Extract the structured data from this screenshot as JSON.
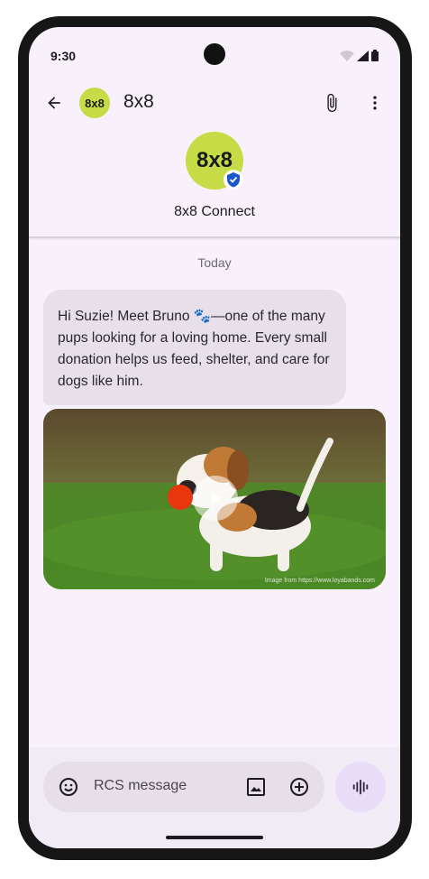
{
  "status_bar": {
    "time": "9:30"
  },
  "top_bar": {
    "avatar_text": "8x8",
    "title": "8x8"
  },
  "profile": {
    "avatar_text": "8x8",
    "name": "8x8 Connect"
  },
  "conversation": {
    "date_separator": "Today",
    "messages": [
      {
        "text": "Hi Suzie! Meet Bruno 🐾—one of the many pups looking for a loving home. Every small donation helps us feed, shelter, and care for dogs like him."
      }
    ],
    "media": {
      "credit": "Image from https://www.loyabands.com"
    }
  },
  "compose": {
    "placeholder": "RCS message"
  },
  "colors": {
    "avatar": "#c6dc46",
    "verified": "#1a56c8",
    "bubble": "#e7e0eb",
    "background": "#f8f1fb",
    "voice_button": "#e8dcf7"
  },
  "icons": {
    "back": "arrow-left-icon",
    "attach": "paperclip-icon",
    "more": "more-vertical-icon",
    "verified": "verified-shield-icon",
    "play": "play-icon",
    "emoji": "emoji-icon",
    "gallery": "image-icon",
    "add": "add-circle-icon",
    "voice": "waveform-icon"
  }
}
